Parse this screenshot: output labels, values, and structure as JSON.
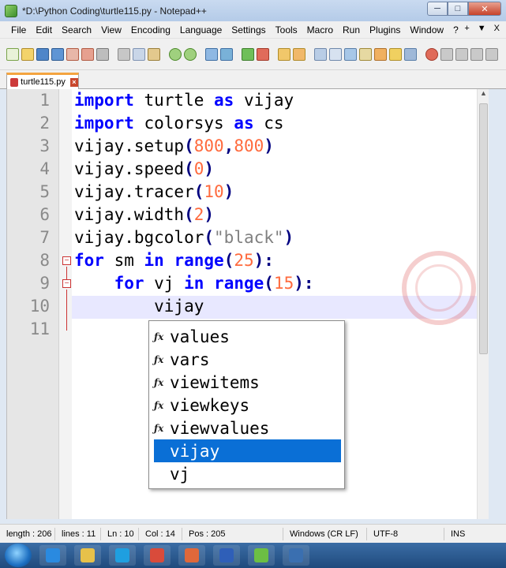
{
  "window": {
    "title": "*D:\\Python Coding\\turtle115.py - Notepad++",
    "controls": [
      "─",
      "□",
      "✕"
    ]
  },
  "menu": [
    "File",
    "Edit",
    "Search",
    "View",
    "Encoding",
    "Language",
    "Settings",
    "Tools",
    "Macro",
    "Run",
    "Plugins",
    "Window",
    "?"
  ],
  "menu_extras": [
    "+",
    "▼",
    "X"
  ],
  "tab": {
    "label": "turtle115.py"
  },
  "editor": {
    "line_numbers": [
      "1",
      "2",
      "3",
      "4",
      "5",
      "6",
      "7",
      "8",
      "9",
      "10",
      "11"
    ],
    "current_line": 10,
    "code": [
      [
        {
          "t": "import",
          "c": "kw"
        },
        {
          "t": " turtle "
        },
        {
          "t": "as",
          "c": "kw"
        },
        {
          "t": " vijay"
        }
      ],
      [
        {
          "t": "import",
          "c": "kw"
        },
        {
          "t": " colorsys "
        },
        {
          "t": "as",
          "c": "kw"
        },
        {
          "t": " cs"
        }
      ],
      [
        {
          "t": "vijay.setup"
        },
        {
          "t": "(",
          "c": "op"
        },
        {
          "t": "800",
          "c": "num"
        },
        {
          "t": ",",
          "c": "op"
        },
        {
          "t": "800",
          "c": "num"
        },
        {
          "t": ")",
          "c": "op"
        }
      ],
      [
        {
          "t": "vijay.speed"
        },
        {
          "t": "(",
          "c": "op"
        },
        {
          "t": "0",
          "c": "num"
        },
        {
          "t": ")",
          "c": "op"
        }
      ],
      [
        {
          "t": "vijay.tracer"
        },
        {
          "t": "(",
          "c": "op"
        },
        {
          "t": "10",
          "c": "num"
        },
        {
          "t": ")",
          "c": "op"
        }
      ],
      [
        {
          "t": "vijay.width"
        },
        {
          "t": "(",
          "c": "op"
        },
        {
          "t": "2",
          "c": "num"
        },
        {
          "t": ")",
          "c": "op"
        }
      ],
      [
        {
          "t": "vijay.bgcolor"
        },
        {
          "t": "(",
          "c": "op"
        },
        {
          "t": "\"black\"",
          "c": "str"
        },
        {
          "t": ")",
          "c": "op"
        }
      ],
      [
        {
          "t": "for",
          "c": "kw"
        },
        {
          "t": " sm "
        },
        {
          "t": "in",
          "c": "kw"
        },
        {
          "t": " "
        },
        {
          "t": "range",
          "c": "kw"
        },
        {
          "t": "(",
          "c": "op"
        },
        {
          "t": "25",
          "c": "num"
        },
        {
          "t": "):",
          "c": "op"
        }
      ],
      [
        {
          "t": "    "
        },
        {
          "t": "for",
          "c": "kw"
        },
        {
          "t": " vj "
        },
        {
          "t": "in",
          "c": "kw"
        },
        {
          "t": " "
        },
        {
          "t": "range",
          "c": "kw"
        },
        {
          "t": "(",
          "c": "op"
        },
        {
          "t": "15",
          "c": "num"
        },
        {
          "t": "):",
          "c": "op"
        }
      ],
      [
        {
          "t": "        vijay"
        }
      ],
      []
    ]
  },
  "autocomplete": {
    "items": [
      {
        "label": "values",
        "icon": "fx"
      },
      {
        "label": "vars",
        "icon": "fx"
      },
      {
        "label": "viewitems",
        "icon": "fx"
      },
      {
        "label": "viewkeys",
        "icon": "fx"
      },
      {
        "label": "viewvalues",
        "icon": "fx"
      },
      {
        "label": "vijay",
        "icon": ""
      },
      {
        "label": "vj",
        "icon": ""
      }
    ],
    "selected_index": 5,
    "selected_color": "#0a6fd6"
  },
  "status": {
    "length": "length : 206",
    "lines": "lines : 11",
    "ln": "Ln : 10",
    "col": "Col : 14",
    "pos": "Pos : 205",
    "eol": "Windows (CR LF)",
    "encoding": "UTF-8",
    "mode": "INS"
  },
  "taskbar": {
    "apps": [
      {
        "name": "ie-icon",
        "color": "#2a8ae0"
      },
      {
        "name": "explorer-icon",
        "color": "#e7c14a"
      },
      {
        "name": "media-player-icon",
        "color": "#1f9fe0"
      },
      {
        "name": "chrome-icon",
        "color": "#d94b3b"
      },
      {
        "name": "powerpoint-icon",
        "color": "#e0683a"
      },
      {
        "name": "word-icon",
        "color": "#2f5fb8"
      },
      {
        "name": "notepadpp-icon",
        "color": "#6cbf44"
      },
      {
        "name": "python-icon",
        "color": "#3a6fb0"
      }
    ]
  }
}
